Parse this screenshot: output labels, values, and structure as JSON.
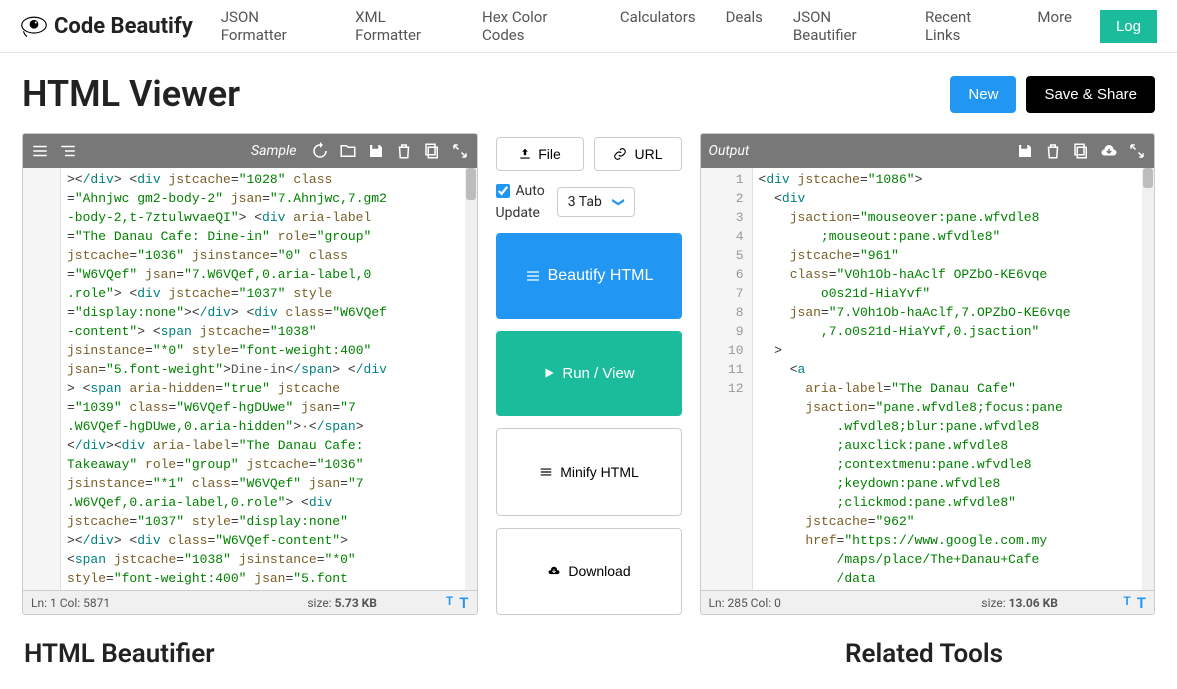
{
  "header": {
    "logo_text": "Code Beautify",
    "nav": [
      "JSON Formatter",
      "XML Formatter",
      "Hex Color Codes",
      "Calculators",
      "Deals",
      "JSON Beautifier",
      "Recent Links",
      "More"
    ],
    "login": "Log"
  },
  "page": {
    "title": "HTML Viewer",
    "new_btn": "New",
    "save_btn": "Save & Share"
  },
  "input_panel": {
    "sample_label": "Sample",
    "status_pos": "Ln: 1 Col: 5871",
    "status_size_label": "size: ",
    "status_size_val": "5.73 KB",
    "code_lines": [
      [
        [
          "p",
          "><"
        ],
        [
          "t",
          "/div"
        ],
        [
          "p",
          "> <"
        ],
        [
          "t",
          "div"
        ],
        [
          "p",
          " "
        ],
        [
          "a",
          "jstcache"
        ],
        [
          "p",
          "="
        ],
        [
          "s",
          "\"1028\""
        ],
        [
          "p",
          " "
        ],
        [
          "a",
          "class"
        ]
      ],
      [
        [
          "p",
          "="
        ],
        [
          "s",
          "\"Ahnjwc gm2-body-2\""
        ],
        [
          "p",
          " "
        ],
        [
          "a",
          "jsan"
        ],
        [
          "p",
          "="
        ],
        [
          "s",
          "\"7.Ahnjwc,7.gm2"
        ]
      ],
      [
        [
          "s",
          "-body-2,t-7ztulwvaeQI\""
        ],
        [
          "p",
          "> <"
        ],
        [
          "t",
          "div"
        ],
        [
          "p",
          " "
        ],
        [
          "a",
          "aria-label"
        ]
      ],
      [
        [
          "p",
          "="
        ],
        [
          "s",
          "\"The Danau Cafe: Dine-in\""
        ],
        [
          "p",
          " "
        ],
        [
          "a",
          "role"
        ],
        [
          "p",
          "="
        ],
        [
          "s",
          "\"group\""
        ]
      ],
      [
        [
          "a",
          "jstcache"
        ],
        [
          "p",
          "="
        ],
        [
          "s",
          "\"1036\""
        ],
        [
          "p",
          " "
        ],
        [
          "a",
          "jsinstance"
        ],
        [
          "p",
          "="
        ],
        [
          "s",
          "\"0\""
        ],
        [
          "p",
          " "
        ],
        [
          "a",
          "class"
        ]
      ],
      [
        [
          "p",
          "="
        ],
        [
          "s",
          "\"W6VQef\""
        ],
        [
          "p",
          " "
        ],
        [
          "a",
          "jsan"
        ],
        [
          "p",
          "="
        ],
        [
          "s",
          "\"7.W6VQef,0.aria-label,0"
        ]
      ],
      [
        [
          "s",
          ".role\""
        ],
        [
          "p",
          "> <"
        ],
        [
          "t",
          "div"
        ],
        [
          "p",
          " "
        ],
        [
          "a",
          "jstcache"
        ],
        [
          "p",
          "="
        ],
        [
          "s",
          "\"1037\""
        ],
        [
          "p",
          " "
        ],
        [
          "a",
          "style"
        ]
      ],
      [
        [
          "p",
          "="
        ],
        [
          "s",
          "\"display:none\""
        ],
        [
          "p",
          "><"
        ],
        [
          "t",
          "/div"
        ],
        [
          "p",
          "> <"
        ],
        [
          "t",
          "div"
        ],
        [
          "p",
          " "
        ],
        [
          "a",
          "class"
        ],
        [
          "p",
          "="
        ],
        [
          "s",
          "\"W6VQef"
        ]
      ],
      [
        [
          "s",
          "-content\""
        ],
        [
          "p",
          "> <"
        ],
        [
          "t",
          "span"
        ],
        [
          "p",
          " "
        ],
        [
          "a",
          "jstcache"
        ],
        [
          "p",
          "="
        ],
        [
          "s",
          "\"1038\""
        ]
      ],
      [
        [
          "a",
          "jsinstance"
        ],
        [
          "p",
          "="
        ],
        [
          "s",
          "\"*0\""
        ],
        [
          "p",
          " "
        ],
        [
          "a",
          "style"
        ],
        [
          "p",
          "="
        ],
        [
          "s",
          "\"font-weight:400\""
        ]
      ],
      [
        [
          "a",
          "jsan"
        ],
        [
          "p",
          "="
        ],
        [
          "s",
          "\"5.font-weight\""
        ],
        [
          "p",
          ">"
        ],
        [
          "o",
          "Dine-in"
        ],
        [
          "p",
          "<"
        ],
        [
          "t",
          "/span"
        ],
        [
          "p",
          "> <"
        ],
        [
          "t",
          "/div"
        ]
      ],
      [
        [
          "p",
          "> <"
        ],
        [
          "t",
          "span"
        ],
        [
          "p",
          " "
        ],
        [
          "a",
          "aria-hidden"
        ],
        [
          "p",
          "="
        ],
        [
          "s",
          "\"true\""
        ],
        [
          "p",
          " "
        ],
        [
          "a",
          "jstcache"
        ]
      ],
      [
        [
          "p",
          "="
        ],
        [
          "s",
          "\"1039\""
        ],
        [
          "p",
          " "
        ],
        [
          "a",
          "class"
        ],
        [
          "p",
          "="
        ],
        [
          "s",
          "\"W6VQef-hgDUwe\""
        ],
        [
          "p",
          " "
        ],
        [
          "a",
          "jsan"
        ],
        [
          "p",
          "="
        ],
        [
          "s",
          "\"7"
        ]
      ],
      [
        [
          "s",
          ".W6VQef-hgDUwe,0.aria-hidden\""
        ],
        [
          "p",
          ">"
        ],
        [
          "o",
          "·"
        ],
        [
          "p",
          "<"
        ],
        [
          "t",
          "/span"
        ],
        [
          "p",
          ">"
        ]
      ],
      [
        [
          "p",
          "<"
        ],
        [
          "t",
          "/div"
        ],
        [
          "p",
          "><"
        ],
        [
          "t",
          "div"
        ],
        [
          "p",
          " "
        ],
        [
          "a",
          "aria-label"
        ],
        [
          "p",
          "="
        ],
        [
          "s",
          "\"The Danau Cafe: "
        ]
      ],
      [
        [
          "s",
          "Takeaway\""
        ],
        [
          "p",
          " "
        ],
        [
          "a",
          "role"
        ],
        [
          "p",
          "="
        ],
        [
          "s",
          "\"group\""
        ],
        [
          "p",
          " "
        ],
        [
          "a",
          "jstcache"
        ],
        [
          "p",
          "="
        ],
        [
          "s",
          "\"1036\""
        ]
      ],
      [
        [
          "a",
          "jsinstance"
        ],
        [
          "p",
          "="
        ],
        [
          "s",
          "\"*1\""
        ],
        [
          "p",
          " "
        ],
        [
          "a",
          "class"
        ],
        [
          "p",
          "="
        ],
        [
          "s",
          "\"W6VQef\""
        ],
        [
          "p",
          " "
        ],
        [
          "a",
          "jsan"
        ],
        [
          "p",
          "="
        ],
        [
          "s",
          "\"7"
        ]
      ],
      [
        [
          "s",
          ".W6VQef,0.aria-label,0.role\""
        ],
        [
          "p",
          "> <"
        ],
        [
          "t",
          "div"
        ]
      ],
      [
        [
          "a",
          "jstcache"
        ],
        [
          "p",
          "="
        ],
        [
          "s",
          "\"1037\""
        ],
        [
          "p",
          " "
        ],
        [
          "a",
          "style"
        ],
        [
          "p",
          "="
        ],
        [
          "s",
          "\"display:none\""
        ]
      ],
      [
        [
          "p",
          "><"
        ],
        [
          "t",
          "/div"
        ],
        [
          "p",
          "> <"
        ],
        [
          "t",
          "div"
        ],
        [
          "p",
          " "
        ],
        [
          "a",
          "class"
        ],
        [
          "p",
          "="
        ],
        [
          "s",
          "\"W6VQef-content\""
        ],
        [
          "p",
          ">"
        ]
      ],
      [
        [
          "p",
          "<"
        ],
        [
          "t",
          "span"
        ],
        [
          "p",
          " "
        ],
        [
          "a",
          "jstcache"
        ],
        [
          "p",
          "="
        ],
        [
          "s",
          "\"1038\""
        ],
        [
          "p",
          " "
        ],
        [
          "a",
          "jsinstance"
        ],
        [
          "p",
          "="
        ],
        [
          "s",
          "\"*0\""
        ]
      ],
      [
        [
          "a",
          "style"
        ],
        [
          "p",
          "="
        ],
        [
          "s",
          "\"font-weight:400\""
        ],
        [
          "p",
          " "
        ],
        [
          "a",
          "jsan"
        ],
        [
          "p",
          "="
        ],
        [
          "s",
          "\"5.font"
        ]
      ]
    ]
  },
  "output_panel": {
    "label": "Output",
    "status_pos": "Ln: 285 Col: 0",
    "status_size_label": "size: ",
    "status_size_val": "13.06 KB",
    "line_numbers": [
      1,
      2,
      3,
      " ",
      4,
      5,
      " ",
      6,
      " ",
      7,
      8,
      9,
      10,
      " ",
      " ",
      " ",
      " ",
      " ",
      11,
      12,
      " ",
      " "
    ],
    "code_lines": [
      [
        [
          "p",
          "<"
        ],
        [
          "t",
          "div"
        ],
        [
          "p",
          " "
        ],
        [
          "a",
          "jstcache"
        ],
        [
          "p",
          "="
        ],
        [
          "s",
          "\"1086\""
        ],
        [
          "p",
          ">"
        ]
      ],
      [
        [
          "p",
          "  <"
        ],
        [
          "t",
          "div"
        ]
      ],
      [
        [
          "p",
          "    "
        ],
        [
          "a",
          "jsaction"
        ],
        [
          "p",
          "="
        ],
        [
          "s",
          "\"mouseover:pane.wfvdle8"
        ]
      ],
      [
        [
          "s",
          "        ;mouseout:pane.wfvdle8\""
        ]
      ],
      [
        [
          "p",
          "    "
        ],
        [
          "a",
          "jstcache"
        ],
        [
          "p",
          "="
        ],
        [
          "s",
          "\"961\""
        ]
      ],
      [
        [
          "p",
          "    "
        ],
        [
          "a",
          "class"
        ],
        [
          "p",
          "="
        ],
        [
          "s",
          "\"V0h1Ob-haAclf OPZbO-KE6vqe"
        ]
      ],
      [
        [
          "s",
          "        o0s21d-HiaYvf\""
        ]
      ],
      [
        [
          "p",
          "    "
        ],
        [
          "a",
          "jsan"
        ],
        [
          "p",
          "="
        ],
        [
          "s",
          "\"7.V0h1Ob-haAclf,7.OPZbO-KE6vqe"
        ]
      ],
      [
        [
          "s",
          "        ,7.o0s21d-HiaYvf,0.jsaction\""
        ]
      ],
      [
        [
          "p",
          "  >"
        ]
      ],
      [
        [
          "p",
          "    <"
        ],
        [
          "t",
          "a"
        ]
      ],
      [
        [
          "p",
          "      "
        ],
        [
          "a",
          "aria-label"
        ],
        [
          "p",
          "="
        ],
        [
          "s",
          "\"The Danau Cafe\""
        ]
      ],
      [
        [
          "p",
          "      "
        ],
        [
          "a",
          "jsaction"
        ],
        [
          "p",
          "="
        ],
        [
          "s",
          "\"pane.wfvdle8;focus:pane"
        ]
      ],
      [
        [
          "s",
          "          .wfvdle8;blur:pane.wfvdle8"
        ]
      ],
      [
        [
          "s",
          "          ;auxclick:pane.wfvdle8"
        ]
      ],
      [
        [
          "s",
          "          ;contextmenu:pane.wfvdle8"
        ]
      ],
      [
        [
          "s",
          "          ;keydown:pane.wfvdle8"
        ]
      ],
      [
        [
          "s",
          "          ;clickmod:pane.wfvdle8\""
        ]
      ],
      [
        [
          "p",
          "      "
        ],
        [
          "a",
          "jstcache"
        ],
        [
          "p",
          "="
        ],
        [
          "s",
          "\"962\""
        ]
      ],
      [
        [
          "p",
          "      "
        ],
        [
          "a",
          "href"
        ],
        [
          "p",
          "="
        ],
        [
          "s",
          "\"https://www.google.com.my"
        ]
      ],
      [
        [
          "s",
          "          /maps/place/The+Danau+Cafe"
        ]
      ],
      [
        [
          "s",
          "          /data"
        ]
      ]
    ]
  },
  "controls": {
    "file_btn": "File",
    "url_btn": "URL",
    "auto_update": "Auto Update",
    "tab_select": "3 Tab",
    "beautify_btn": "Beautify HTML",
    "run_btn": "Run / View",
    "minify_btn": "Minify HTML",
    "download_btn": "Download"
  },
  "bottom": {
    "left_title": "HTML Beautifier",
    "right_title": "Related Tools"
  }
}
